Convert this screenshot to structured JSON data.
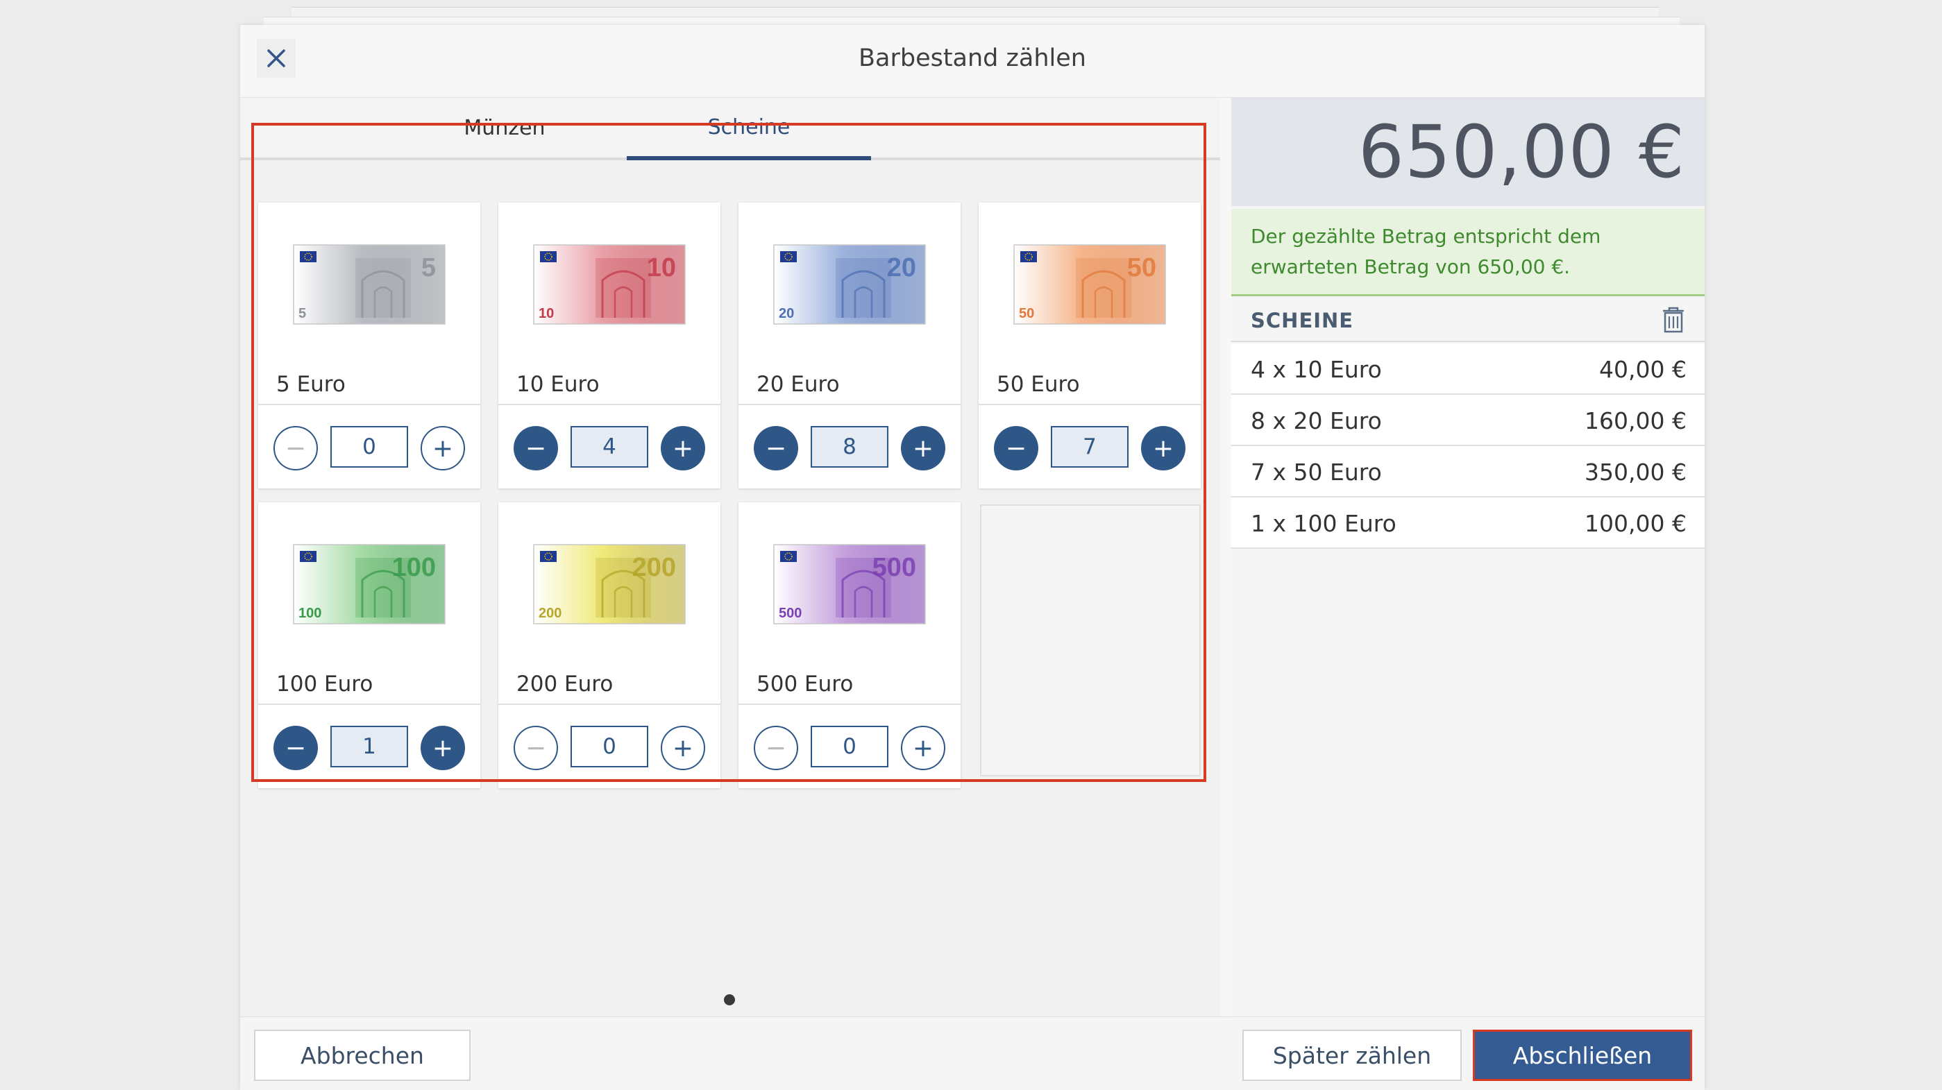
{
  "dialog": {
    "title": "Barbestand zählen"
  },
  "tabs": [
    {
      "label": "Münzen",
      "active": false
    },
    {
      "label": "Scheine",
      "active": true
    }
  ],
  "notes": [
    {
      "label": "5 Euro",
      "value": "5",
      "qty": "0",
      "color": "#b9bcc2",
      "accent": "#8d9198"
    },
    {
      "label": "10 Euro",
      "value": "10",
      "qty": "4",
      "color": "#e9a1a8",
      "accent": "#c23b4a"
    },
    {
      "label": "20 Euro",
      "value": "20",
      "qty": "8",
      "color": "#9db3dc",
      "accent": "#4e6fb3"
    },
    {
      "label": "50 Euro",
      "value": "50",
      "qty": "7",
      "color": "#f5b48a",
      "accent": "#e07a3c"
    },
    {
      "label": "100 Euro",
      "value": "100",
      "qty": "1",
      "color": "#a6dba6",
      "accent": "#3a9a4a"
    },
    {
      "label": "200 Euro",
      "value": "200",
      "qty": "0",
      "color": "#f0ea7a",
      "accent": "#b5a52a"
    },
    {
      "label": "500 Euro",
      "value": "500",
      "qty": "0",
      "color": "#c6a2de",
      "accent": "#7a3fb0"
    }
  ],
  "total": "650,00 €",
  "info_message": "Der gezählte Betrag entspricht dem erwarteten Betrag von 650,00 €.",
  "summary": {
    "title": "SCHEINE",
    "rows": [
      {
        "label": "4 x 10 Euro",
        "amount": "40,00 €"
      },
      {
        "label": "8 x 20 Euro",
        "amount": "160,00 €"
      },
      {
        "label": "7 x 50 Euro",
        "amount": "350,00 €"
      },
      {
        "label": "1 x 100 Euro",
        "amount": "100,00 €"
      }
    ]
  },
  "footer": {
    "cancel_label": "Abbrechen",
    "later_label": "Später zählen",
    "finish_label": "Abschließen"
  },
  "icons": {
    "close": "close-icon",
    "trash": "trash-icon",
    "minus": "minus-icon",
    "plus": "plus-icon",
    "eu_flag": "eu-flag-icon"
  },
  "colors": {
    "primary": "#2e5686",
    "highlight": "#d63a22",
    "success_text": "#3f8a2e",
    "success_bg": "#e7f3df"
  }
}
